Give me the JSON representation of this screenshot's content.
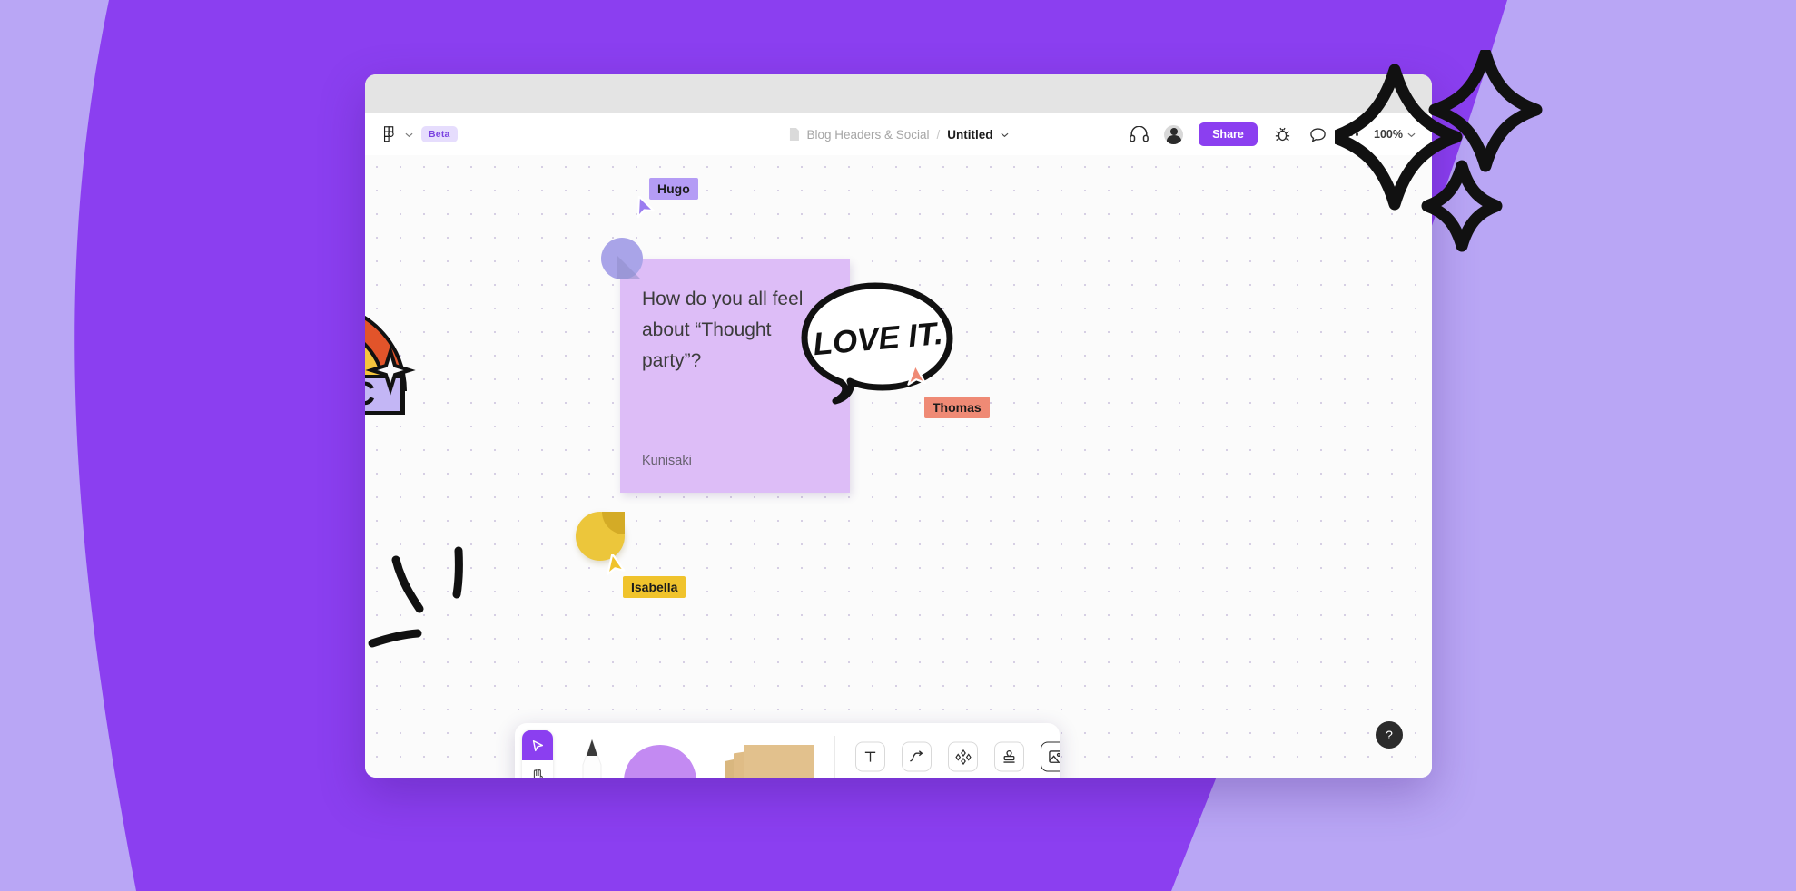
{
  "background": {
    "base_color": "#8B3FF0",
    "blob_color": "#B9A6F5"
  },
  "window": {
    "title_bar_color": "#e4e4e4",
    "canvas_color": "#fbfbfb"
  },
  "header": {
    "logo_icon": "figma-logo-icon",
    "logo_chevron_icon": "chevron-down-icon",
    "beta_label": "Beta",
    "file_icon": "file-icon",
    "breadcrumb_project": "Blog Headers & Social",
    "breadcrumb_separator": "/",
    "breadcrumb_file": "Untitled",
    "breadcrumb_chevron_icon": "chevron-down-icon",
    "headphones_icon": "headphones-icon",
    "avatar_name": "user-avatar",
    "share_label": "Share",
    "bug_icon": "bug-icon",
    "comment_icon": "comment-bubble-icon",
    "more_icon": "more-options-icon",
    "zoom_level": "100%",
    "zoom_chevron_icon": "chevron-down-icon",
    "accent_color": "#8B3FF0"
  },
  "canvas": {
    "sticky_note": {
      "text": "How do you all feel about “Thought party”?",
      "author": "Kunisaki",
      "color": "#ddbdf7"
    },
    "speech_bubble": {
      "text": "LOVE IT."
    },
    "magic_sticker": {
      "label": "MAGIC",
      "banner_color": "#c3b6f5",
      "arc_colors": [
        "#e2542a",
        "#f5c53d",
        "#a477f0"
      ]
    },
    "cursors": [
      {
        "name": "Hugo",
        "color": "#b49cf5",
        "text_color": "#1b1b1b"
      },
      {
        "name": "Thomas",
        "color": "#ef8a75",
        "text_color": "#1b1b1b"
      },
      {
        "name": "Isabella",
        "color": "#f0c32c",
        "text_color": "#1b1b1b"
      }
    ]
  },
  "toolbar": {
    "select_tool": "select-cursor-tool",
    "hand_tool": "hand-pan-tool",
    "pen_tool": "pen-tool",
    "shape_tool": "shape-tool",
    "sticky_note_tool": "sticky-note-tool",
    "text_tool": "text-tool",
    "connector_tool": "connector-tool",
    "shapes_tool": "shapes-library-tool",
    "stamp_tool": "stamp-tool",
    "image_tool": "image-tool"
  },
  "help": {
    "label": "?"
  }
}
